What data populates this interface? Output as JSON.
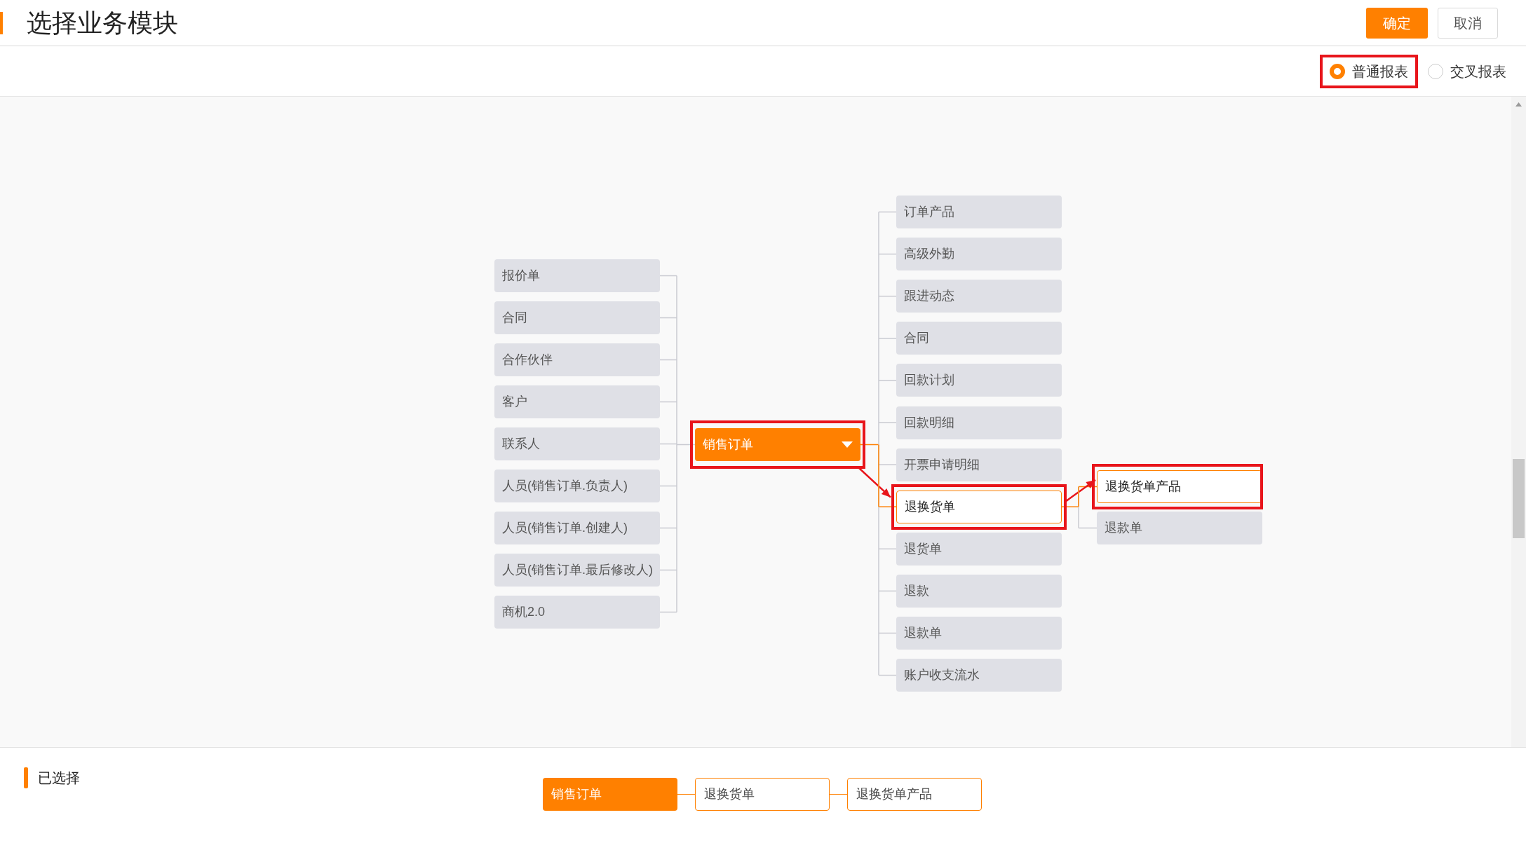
{
  "header": {
    "title": "选择业务模块",
    "buttons": [
      {
        "label": "确定",
        "kind": "primary"
      },
      {
        "label": "取消",
        "kind": "secondary"
      }
    ]
  },
  "report_types": [
    {
      "label": "普通报表",
      "selected": true,
      "highlighted": true
    },
    {
      "label": "交叉报表",
      "selected": false,
      "highlighted": false
    }
  ],
  "diagram": {
    "left_nodes": [
      {
        "label": "报价单"
      },
      {
        "label": "合同"
      },
      {
        "label": "合作伙伴"
      },
      {
        "label": "客户"
      },
      {
        "label": "联系人"
      },
      {
        "label": "人员(销售订单.负责人)"
      },
      {
        "label": "人员(销售订单.创建人)"
      },
      {
        "label": "人员(销售订单.最后修改人)"
      },
      {
        "label": "商机2.0"
      }
    ],
    "center_node": {
      "label": "销售订单",
      "highlighted": true
    },
    "right_nodes": [
      {
        "label": "订单产品",
        "selected": false,
        "highlighted": false
      },
      {
        "label": "高级外勤",
        "selected": false,
        "highlighted": false
      },
      {
        "label": "跟进动态",
        "selected": false,
        "highlighted": false
      },
      {
        "label": "合同",
        "selected": false,
        "highlighted": false
      },
      {
        "label": "回款计划",
        "selected": false,
        "highlighted": false
      },
      {
        "label": "回款明细",
        "selected": false,
        "highlighted": false
      },
      {
        "label": "开票申请明细",
        "selected": false,
        "highlighted": false
      },
      {
        "label": "退换货单",
        "selected": true,
        "highlighted": true
      },
      {
        "label": "退货单",
        "selected": false,
        "highlighted": false
      },
      {
        "label": "退款",
        "selected": false,
        "highlighted": false
      },
      {
        "label": "退款单",
        "selected": false,
        "highlighted": false
      },
      {
        "label": "账户收支流水",
        "selected": false,
        "highlighted": false
      }
    ],
    "sub_nodes": [
      {
        "label": "退换货单产品",
        "selected": true,
        "highlighted": true
      },
      {
        "label": "退款单",
        "selected": false,
        "highlighted": false
      }
    ]
  },
  "selected_section": {
    "title": "已选择",
    "chain": [
      {
        "label": "销售订单",
        "kind": "root"
      },
      {
        "label": "退换货单",
        "kind": "child"
      },
      {
        "label": "退换货单产品",
        "kind": "child"
      }
    ]
  }
}
